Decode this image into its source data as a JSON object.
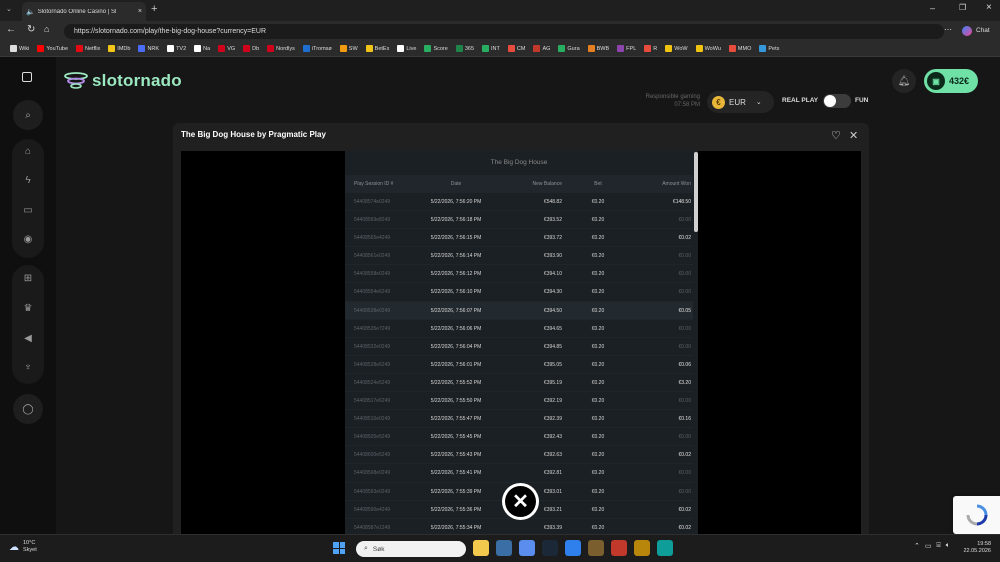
{
  "browser": {
    "tab_title": "Slotornado Online Casino | Sl",
    "new_tab": "+",
    "url": "https://slotornado.com/play/the-big-dog-house?currency=EUR",
    "chat_label": "Chat",
    "bookmarks": [
      {
        "label": "Wiki",
        "color": "#dddddd"
      },
      {
        "label": "YouTube",
        "color": "#ff0000"
      },
      {
        "label": "Netflix",
        "color": "#e50914"
      },
      {
        "label": "IMDb",
        "color": "#f5c518"
      },
      {
        "label": "NRK",
        "color": "#4a6cf7"
      },
      {
        "label": "TV2",
        "color": "#ffffff"
      },
      {
        "label": "Na",
        "color": "#ffffff"
      },
      {
        "label": "VG",
        "color": "#d0021b"
      },
      {
        "label": "Db",
        "color": "#d0021b"
      },
      {
        "label": "Nordlys",
        "color": "#d0021b"
      },
      {
        "label": "iTromsø",
        "color": "#1f6fd0"
      },
      {
        "label": "SW",
        "color": "#f39c12"
      },
      {
        "label": "BetEx",
        "color": "#f0c419"
      },
      {
        "label": "Live",
        "color": "#ffffff"
      },
      {
        "label": "Score",
        "color": "#27ae60"
      },
      {
        "label": "365",
        "color": "#1e8449"
      },
      {
        "label": "INT",
        "color": "#27ae60"
      },
      {
        "label": "CM",
        "color": "#e74c3c"
      },
      {
        "label": "AG",
        "color": "#c0392b"
      },
      {
        "label": "Gura",
        "color": "#27ae60"
      },
      {
        "label": "BWB",
        "color": "#e67e22"
      },
      {
        "label": "FPL",
        "color": "#8e44ad"
      },
      {
        "label": "R",
        "color": "#e74c3c"
      },
      {
        "label": "WoW",
        "color": "#f1c40f"
      },
      {
        "label": "WoWu",
        "color": "#f1c40f"
      },
      {
        "label": "MMO",
        "color": "#e74c3c"
      },
      {
        "label": "Pets",
        "color": "#3498db"
      }
    ]
  },
  "site": {
    "logo": "slotornado",
    "responsible_gaming": "Responsible gaming",
    "time": "07:58 PM",
    "currency": "EUR",
    "currency_symbol": "€",
    "real_play": "REAL PLAY",
    "fun": "FUN",
    "balance": "432€"
  },
  "modal": {
    "title": "The Big Dog House by Pragmatic Play",
    "history_title": "The Big Dog House",
    "columns": [
      "Play Session ID #",
      "Date",
      "New Balance",
      "Bet",
      "Amount Won"
    ],
    "rows": [
      {
        "id": "54408574e0249",
        "date": "5/22/2026, 7:56:20 PM",
        "balance": "€548.82",
        "bet": "€0.20",
        "won": "€148.50",
        "win": true
      },
      {
        "id": "54408569e8249",
        "date": "5/22/2026, 7:56:18 PM",
        "balance": "€393.52",
        "bet": "€0.20",
        "won": "€0.00",
        "win": false
      },
      {
        "id": "54408565e4249",
        "date": "5/22/2026, 7:56:15 PM",
        "balance": "€393.72",
        "bet": "€0.20",
        "won": "€0.02",
        "win": true
      },
      {
        "id": "54408561e0249",
        "date": "5/22/2026, 7:56:14 PM",
        "balance": "€393.90",
        "bet": "€0.20",
        "won": "€0.00",
        "win": false
      },
      {
        "id": "54408558e0249",
        "date": "5/22/2026, 7:56:12 PM",
        "balance": "€394.10",
        "bet": "€0.20",
        "won": "€0.00",
        "win": false
      },
      {
        "id": "54408554e6249",
        "date": "5/22/2026, 7:56:10 PM",
        "balance": "€394.30",
        "bet": "€0.20",
        "won": "€0.00",
        "win": false
      },
      {
        "id": "54408538e0249",
        "date": "5/22/2026, 7:56:07 PM",
        "balance": "€394.50",
        "bet": "€0.20",
        "won": "€0.05",
        "win": true,
        "highlight": true
      },
      {
        "id": "54408535e7249",
        "date": "5/22/2026, 7:56:06 PM",
        "balance": "€394.65",
        "bet": "€0.20",
        "won": "€0.00",
        "win": false
      },
      {
        "id": "54408532e0249",
        "date": "5/22/2026, 7:56:04 PM",
        "balance": "€394.85",
        "bet": "€0.20",
        "won": "€0.00",
        "win": false
      },
      {
        "id": "54408528e6249",
        "date": "5/22/2026, 7:56:01 PM",
        "balance": "€395.05",
        "bet": "€0.20",
        "won": "€0.06",
        "win": true
      },
      {
        "id": "54408524e5249",
        "date": "5/22/2026, 7:55:52 PM",
        "balance": "€395.19",
        "bet": "€0.20",
        "won": "€3.20",
        "win": true
      },
      {
        "id": "54408517e6249",
        "date": "5/22/2026, 7:55:50 PM",
        "balance": "€392.19",
        "bet": "€0.20",
        "won": "€0.00",
        "win": false
      },
      {
        "id": "54408510e0249",
        "date": "5/22/2026, 7:55:47 PM",
        "balance": "€392.39",
        "bet": "€0.20",
        "won": "€0.16",
        "win": true
      },
      {
        "id": "54408505e5249",
        "date": "5/22/2026, 7:55:45 PM",
        "balance": "€392.43",
        "bet": "€0.20",
        "won": "€0.00",
        "win": false
      },
      {
        "id": "54408600e5249",
        "date": "5/22/2026, 7:55:43 PM",
        "balance": "€392.63",
        "bet": "€0.20",
        "won": "€0.02",
        "win": true
      },
      {
        "id": "54408598e0249",
        "date": "5/22/2026, 7:55:41 PM",
        "balance": "€392.81",
        "bet": "€0.20",
        "won": "€0.00",
        "win": false
      },
      {
        "id": "54408593e0249",
        "date": "5/22/2026, 7:55:39 PM",
        "balance": "€393.01",
        "bet": "€0.20",
        "won": "€0.00",
        "win": false
      },
      {
        "id": "54408590e4249",
        "date": "5/22/2026, 7:55:36 PM",
        "balance": "€393.21",
        "bet": "€0.20",
        "won": "€0.02",
        "win": true
      },
      {
        "id": "54408587e1249",
        "date": "5/22/2026, 7:55:34 PM",
        "balance": "€393.39",
        "bet": "€0.20",
        "won": "€0.02",
        "win": true
      }
    ]
  },
  "taskbar": {
    "temperature": "10°C",
    "weather": "Skyet",
    "search_placeholder": "Søk",
    "clock_time": "19:58",
    "clock_date": "22.05.2026",
    "apps": [
      {
        "name": "file-explorer",
        "color": "#f2c94c"
      },
      {
        "name": "calculator",
        "color": "#3a6ea5"
      },
      {
        "name": "calendar",
        "color": "#5b8def"
      },
      {
        "name": "steam",
        "color": "#1b2838"
      },
      {
        "name": "mail",
        "color": "#2f80ed"
      },
      {
        "name": "game",
        "color": "#7b5e2e"
      },
      {
        "name": "battle-net",
        "color": "#c0392b"
      },
      {
        "name": "wow",
        "color": "#b8860b"
      },
      {
        "name": "edge",
        "color": "#0f9d9a"
      }
    ]
  }
}
